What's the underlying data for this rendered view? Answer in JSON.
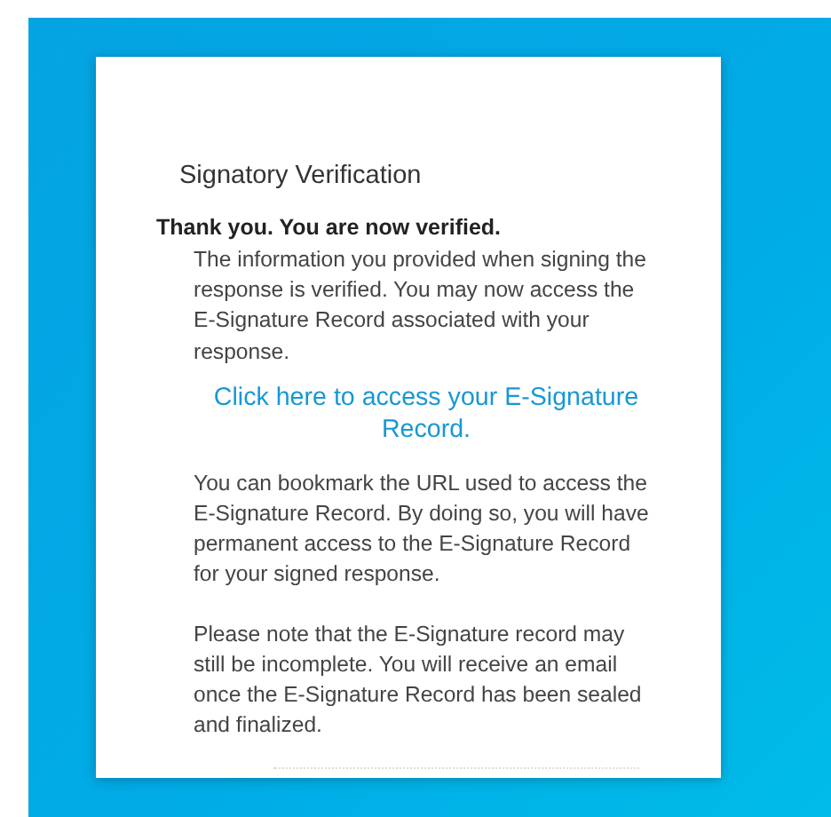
{
  "title": "Signatory Verification",
  "heading": "Thank you. You are now verified.",
  "intro": "The information you provided when signing the response is verified. You may now access the E-Signature Record associated with your response.",
  "link": "Click here to access your E-Signature Record.",
  "paragraphs": [
    "You can bookmark the URL used to access the E-Signature Record. By doing so, you will have permanent access to the E-Signature Record for your signed response.",
    "Please note that the E-Signature record may still be incomplete. You will receive an email once the E-Signature Record has been sealed and finalized."
  ]
}
